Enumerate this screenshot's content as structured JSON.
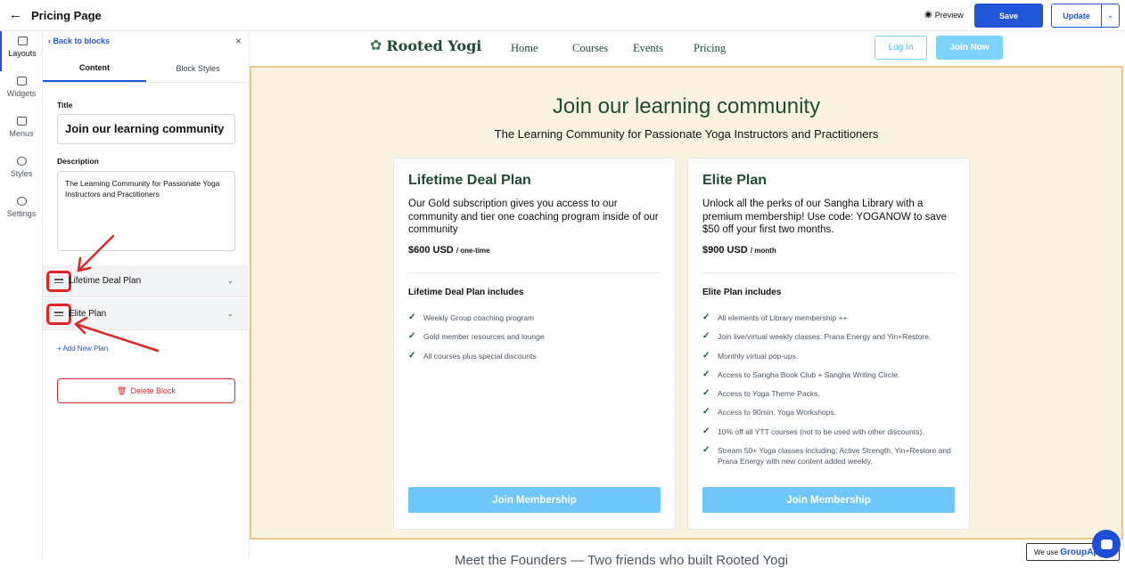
{
  "topbar": {
    "page_title": "Pricing Page",
    "preview_label": "Preview",
    "save_label": "Save",
    "update_label": "Update"
  },
  "rail": {
    "items": [
      {
        "label": "Layouts",
        "icon": "layouts-icon"
      },
      {
        "label": "Widgets",
        "icon": "widgets-icon"
      },
      {
        "label": "Menus",
        "icon": "menus-icon"
      },
      {
        "label": "Styles",
        "icon": "palette-icon"
      },
      {
        "label": "Settings",
        "icon": "gear-icon"
      }
    ]
  },
  "panel": {
    "back_label": "Back to blocks",
    "tabs": [
      "Content",
      "Block Styles"
    ],
    "title_label": "Title",
    "title_value": "Join our learning community",
    "description_label": "Description",
    "description_value": "The Learning Community for Passionate Yoga Instructors and Practitioners",
    "plans": [
      "Lifetime Deal Plan",
      "Elite Plan"
    ],
    "add_plan_label": "+ Add New Plan",
    "delete_label": "Delete Block"
  },
  "site": {
    "brand": "Rooted Yogi",
    "nav": [
      "Home",
      "Courses",
      "Events",
      "Pricing"
    ],
    "login_label": "Log In",
    "join_now_label": "Join Now",
    "block_title": "Join our learning community",
    "block_subtitle": "The Learning Community for Passionate Yoga Instructors and Practitioners",
    "cards": [
      {
        "name": "Lifetime Deal Plan",
        "description": "Our Gold subscription gives you access to our community and tier one coaching program inside of our community",
        "price": "$600 USD",
        "price_unit": "/ one-time",
        "includes_heading": "Lifetime Deal Plan includes",
        "features": [
          "Weekly Group coaching program",
          "Gold member resources and lounge",
          "All courses plus special discounts"
        ],
        "cta": "Join Membership"
      },
      {
        "name": "Elite Plan",
        "description": "Unlock all the perks of our Sangha Library with a premium membership! Use code: YOGANOW to save $50 off your first two months.",
        "price": "$900 USD",
        "price_unit": "/ month",
        "includes_heading": "Elite Plan includes",
        "features": [
          "All elements of Library membership ++",
          "Join live/virtual weekly classes: Prana Energy and Yin+Restore.",
          "Monthly virtual pop-ups.",
          "Access to Sangha Book Club + Sangha Writing Circle.",
          "Access to Yoga Theme Packs.",
          "Access to 90min. Yoga Workshops.",
          "10% off all YTT courses (not to be used with other discounts).",
          "Stream 50+ Yoga classes including: Active Strength, Yin+Restore and Prana Energy with new content added weekly."
        ],
        "cta": "Join Membership"
      }
    ],
    "below_text": "Meet the Founders — Two friends who built Rooted Yogi",
    "cookie_prefix": "We use",
    "cookie_brand": "GroupApp"
  },
  "colors": {
    "accent": "#2156d8",
    "brand_green": "#1e4d35",
    "block_bg": "#faf3e2",
    "block_border": "#f5c48a",
    "cta": "#6ec6f9",
    "annotation": "#e02424"
  }
}
